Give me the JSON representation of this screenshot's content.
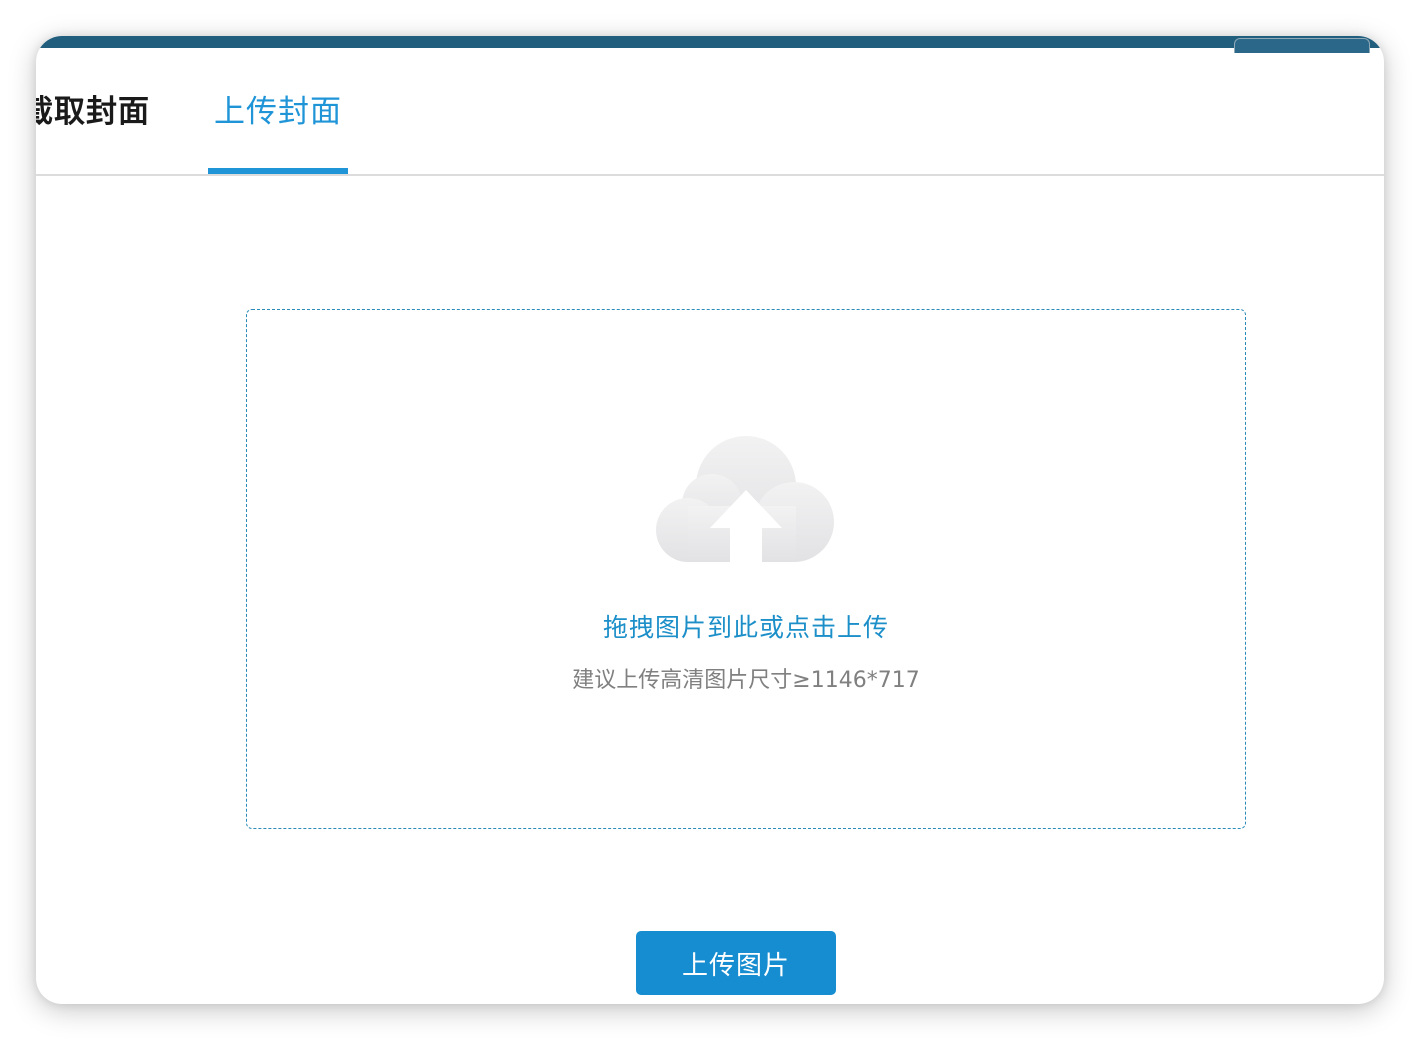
{
  "tabs": [
    {
      "label": "截取封面",
      "active": false
    },
    {
      "label": "上传封面",
      "active": true
    }
  ],
  "dropzone": {
    "icon": "cloud-upload-icon",
    "primary_text": "拖拽图片到此或点击上传",
    "secondary_text": "建议上传高清图片尺寸≥1146*717"
  },
  "actions": {
    "upload_label": "上传图片"
  },
  "colors": {
    "accent": "#1f95d8",
    "button": "#158dd0",
    "header_strip": "#215e7e",
    "muted_text": "#808080"
  }
}
